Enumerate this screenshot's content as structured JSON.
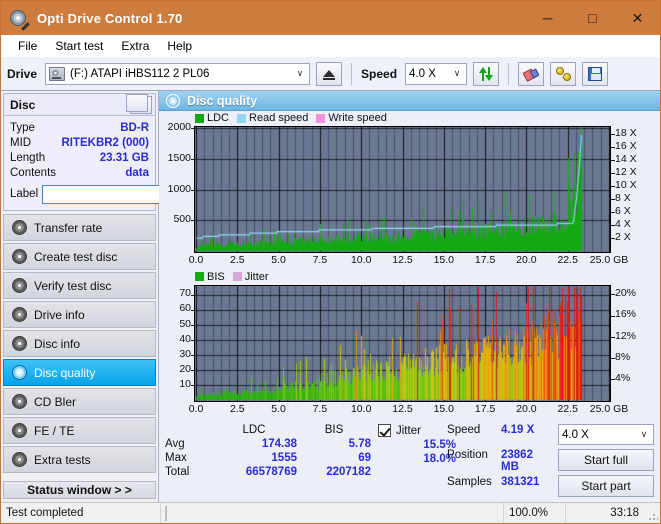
{
  "window": {
    "title": "Opti Drive Control 1.70",
    "icon": "disc-pen-icon",
    "minimize": "─",
    "maximize": "□",
    "close": "✕",
    "titlebar_color": "#cd7c3e"
  },
  "menu": {
    "items": [
      {
        "label": "File"
      },
      {
        "label": "Start test"
      },
      {
        "label": "Extra"
      },
      {
        "label": "Help"
      }
    ]
  },
  "toolbar": {
    "drive_label": "Drive",
    "drive_value": "(F:)  ATAPI iHBS112   2 PL06",
    "drive_caret": "∨",
    "eject_tooltip": "eject-icon",
    "speed_label": "Speed",
    "speed_value": "4.0 X",
    "speed_caret": "∨",
    "refresh_icon": "refresh-icon",
    "erase_icon": "eraser-icon",
    "bulb_icon": "gold-discs-icon",
    "save_icon": "save-icon"
  },
  "sidebar": {
    "disc_panel": {
      "title": "Disc",
      "refresh_icon": "refresh-icon",
      "rows": [
        {
          "key": "Type",
          "value": "BD-R"
        },
        {
          "key": "MID",
          "value": "RITEKBR2 (000)"
        },
        {
          "key": "Length",
          "value": "23.31 GB"
        },
        {
          "key": "Contents",
          "value": "data"
        }
      ],
      "label_key": "Label",
      "label_value": "",
      "label_placeholder": "",
      "label_button_icon": "disc-icon"
    },
    "nav": [
      {
        "label": "Transfer rate",
        "active": false
      },
      {
        "label": "Create test disc",
        "active": false
      },
      {
        "label": "Verify test disc",
        "active": false
      },
      {
        "label": "Drive info",
        "active": false
      },
      {
        "label": "Disc info",
        "active": false
      },
      {
        "label": "Disc quality",
        "active": true
      },
      {
        "label": "CD Bler",
        "active": false
      },
      {
        "label": "FE / TE",
        "active": false
      },
      {
        "label": "Extra tests",
        "active": false
      }
    ],
    "status_window_button": "Status window > >"
  },
  "main": {
    "panel_title": "Disc quality",
    "panel_icon": "disc-quality-icon"
  },
  "stats": {
    "columns": [
      "LDC",
      "BIS"
    ],
    "rows": [
      {
        "key": "Avg",
        "ldc": "174.38",
        "bis": "5.78"
      },
      {
        "key": "Max",
        "ldc": "1555",
        "bis": "69"
      },
      {
        "key": "Total",
        "ldc": "66578769",
        "bis": "2207182"
      }
    ],
    "jitter": {
      "label": "Jitter",
      "checked": true,
      "avg": "15.5%",
      "max": "18.0%"
    },
    "speed_key": "Speed",
    "speed_value": "4.19 X",
    "position_key": "Position",
    "position_value": "23862 MB",
    "samples_key": "Samples",
    "samples_value": "381321",
    "speed_select": "4.0 X",
    "speed_select_caret": "∨",
    "start_full": "Start full",
    "start_part": "Start part"
  },
  "statusbar": {
    "text": "Test completed",
    "percent_label": "100.0%",
    "percent_value": 100,
    "time": "33:18",
    "progress_color": "#10a810"
  },
  "chart_data": [
    {
      "id": "top",
      "type": "area",
      "title": "",
      "xlabel": "GB",
      "ylabel": "LDC",
      "y2label": "Speed (X)",
      "xlim": [
        0,
        25
      ],
      "ylim": [
        0,
        2000
      ],
      "y2lim": [
        0,
        19
      ],
      "xticks": [
        "0.0",
        "2.5",
        "5.0",
        "7.5",
        "10.0",
        "12.5",
        "15.0",
        "17.5",
        "20.0",
        "22.5",
        "25.0 GB"
      ],
      "yticks": [
        500,
        1000,
        1500,
        2000
      ],
      "y2ticks": [
        "2 X",
        "4 X",
        "6 X",
        "8 X",
        "10 X",
        "12 X",
        "14 X",
        "16 X",
        "18 X"
      ],
      "grid": true,
      "legend": [
        {
          "name": "LDC",
          "color": "#14a814"
        },
        {
          "name": "Read speed",
          "color": "#92d6f5"
        },
        {
          "name": "Write speed",
          "color": "#f58fd6"
        }
      ],
      "data_end_x": 23.31,
      "series": [
        {
          "name": "LDC",
          "color": "#14a814",
          "kind": "spiky-area",
          "x": [
            0.0,
            0.5,
            1.0,
            1.5,
            2.0,
            2.5,
            3.0,
            3.5,
            4.0,
            4.5,
            5.0,
            5.5,
            6.0,
            6.5,
            7.0,
            7.5,
            8.0,
            8.5,
            9.0,
            9.5,
            10.0,
            10.5,
            11.0,
            11.5,
            12.0,
            12.5,
            13.0,
            13.5,
            14.0,
            14.5,
            15.0,
            15.5,
            16.0,
            16.5,
            17.0,
            17.5,
            18.0,
            18.5,
            19.0,
            19.5,
            20.0,
            20.5,
            21.0,
            21.5,
            22.0,
            22.5,
            23.0,
            23.3
          ],
          "values": [
            70,
            95,
            110,
            105,
            120,
            115,
            130,
            125,
            140,
            150,
            160,
            155,
            170,
            175,
            185,
            180,
            195,
            205,
            200,
            215,
            225,
            230,
            240,
            250,
            245,
            260,
            270,
            280,
            275,
            290,
            300,
            310,
            320,
            330,
            340,
            350,
            365,
            380,
            395,
            410,
            425,
            445,
            470,
            500,
            540,
            620,
            900,
            1555
          ]
        },
        {
          "name": "Read speed",
          "color": "#92d6f5",
          "kind": "step-line",
          "x": [
            0.0,
            1.0,
            2.0,
            3.0,
            4.0,
            5.0,
            6.5,
            8.0,
            9.5,
            11.0,
            12.5,
            14.0,
            15.5,
            17.0,
            18.5,
            20.0,
            21.5,
            22.8,
            23.0,
            23.2,
            23.3
          ],
          "values": [
            2.0,
            2.3,
            2.5,
            2.6,
            2.7,
            2.9,
            3.0,
            3.2,
            3.3,
            3.4,
            3.5,
            3.6,
            3.7,
            3.8,
            3.9,
            4.0,
            4.1,
            4.2,
            8.0,
            14.0,
            18.0
          ]
        }
      ]
    },
    {
      "id": "bottom",
      "type": "area",
      "title": "",
      "xlabel": "GB",
      "ylabel": "BIS",
      "y2label": "Jitter (%)",
      "xlim": [
        0,
        25
      ],
      "ylim": [
        0,
        75
      ],
      "y2lim": [
        0,
        21.4
      ],
      "xticks": [
        "0.0",
        "2.5",
        "5.0",
        "7.5",
        "10.0",
        "12.5",
        "15.0",
        "17.5",
        "20.0",
        "22.5",
        "25.0 GB"
      ],
      "yticks": [
        10,
        20,
        30,
        40,
        50,
        60,
        70
      ],
      "y2ticks": [
        "4%",
        "8%",
        "12%",
        "16%",
        "20%"
      ],
      "grid": true,
      "legend": [
        {
          "name": "BIS",
          "color": "#14a814"
        },
        {
          "name": "Jitter",
          "color": "#d7a8d7"
        }
      ],
      "data_end_x": 23.31,
      "series": [
        {
          "name": "BIS",
          "color": "gradient-green-yellow-orange-red",
          "kind": "spiky-area",
          "x": [
            0.0,
            0.5,
            1.0,
            1.5,
            2.0,
            2.5,
            3.0,
            3.5,
            4.0,
            4.5,
            5.0,
            5.5,
            6.0,
            6.5,
            7.0,
            7.5,
            8.0,
            8.5,
            9.0,
            9.5,
            10.0,
            10.5,
            11.0,
            11.5,
            12.0,
            12.5,
            13.0,
            13.5,
            14.0,
            14.5,
            15.0,
            15.5,
            16.0,
            16.5,
            17.0,
            17.5,
            18.0,
            18.5,
            19.0,
            19.5,
            20.0,
            20.5,
            21.0,
            21.5,
            22.0,
            22.5,
            23.0,
            23.3
          ],
          "values": [
            3,
            4,
            4,
            5,
            5,
            5,
            6,
            6,
            7,
            7,
            8,
            9,
            10,
            11,
            12,
            13,
            15,
            16,
            17,
            18,
            19,
            20,
            21,
            22,
            23,
            24,
            25,
            26,
            27,
            28,
            29,
            30,
            31,
            32,
            33,
            34,
            35,
            36,
            37,
            38,
            40,
            42,
            44,
            47,
            50,
            55,
            62,
            69
          ]
        },
        {
          "name": "Jitter",
          "color": "#d7a8d7",
          "kind": "noisy-line",
          "x": [
            0.0,
            1.0,
            2.0,
            3.0,
            4.0,
            5.0,
            6.0,
            7.0,
            8.0,
            9.0,
            10.0,
            11.0,
            12.0,
            13.0,
            14.0,
            15.0,
            16.0,
            17.0,
            18.0,
            19.0,
            20.0,
            21.0,
            22.0,
            23.0,
            23.3
          ],
          "values": [
            47,
            47,
            47.5,
            47,
            48,
            48.5,
            49,
            54,
            55,
            55.5,
            56,
            56.5,
            57,
            57.5,
            57,
            57.5,
            54,
            54.5,
            55,
            55,
            55.5,
            56,
            56.5,
            58,
            60
          ]
        }
      ]
    }
  ]
}
